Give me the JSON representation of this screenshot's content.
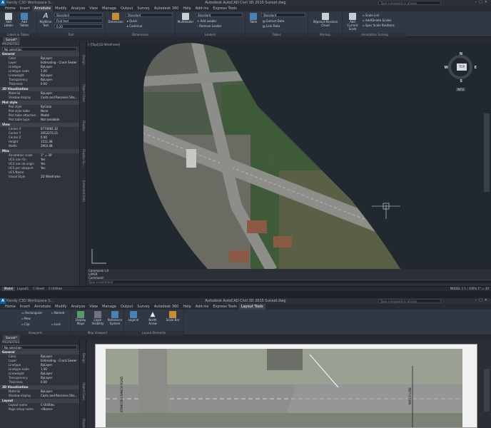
{
  "w1": {
    "title": "Autodesk AutoCAD Civil 3D 2015   Sunset.dwg",
    "qa": "Randy C3D Workspace S...",
    "search": "Type a keyword or phrase",
    "tabs": [
      "Home",
      "Insert",
      "Annotate",
      "Modify",
      "Analyze",
      "View",
      "Manage",
      "Output",
      "Survey",
      "Autodesk 360",
      "Help",
      "Add-ins",
      "Express Tools"
    ],
    "active_tab": "Annotate",
    "ribbon": {
      "labels_tables": {
        "b1": "Add Labels",
        "b2": "Add Tables",
        "label": "Labels & Tables"
      },
      "text": {
        "b1": "Multiline Text",
        "dd1": "Standard",
        "dd2": "Find text",
        "dd3": "0.20",
        "label": "Text"
      },
      "dim": {
        "b1": "Dimension",
        "dd1": "Standard",
        "s1": "Quick",
        "s2": "Continue",
        "label": "Dimensions"
      },
      "leaders": {
        "b1": "Multileader",
        "dd1": "Standard",
        "s1": "Add Leader",
        "s2": "Remove Leader",
        "label": "Leaders"
      },
      "tables": {
        "b1": "Table",
        "dd1": "Standard",
        "s1": "Extract Data",
        "s2": "Link Data",
        "label": "Tables"
      },
      "markup": {
        "b1": "Wipeout Revision Cloud",
        "label": "Markup"
      },
      "scaling": {
        "b1": "Add Current Scale",
        "s1": "Scale List",
        "s2": "Add/Delete Scales",
        "s3": "Sync Scale Positions",
        "label": "Annotation Scaling"
      }
    },
    "doc_tab": "Sunset*",
    "props": {
      "title": "PROPERTIES",
      "select": "No selection",
      "sections": [
        {
          "name": "General",
          "rows": [
            [
              "Color",
              "ByLayer"
            ],
            [
              "Layer",
              "Estimating - Crack Sealer"
            ],
            [
              "Linetype",
              "ByLayer"
            ],
            [
              "Linetype scale",
              "1.00"
            ],
            [
              "Lineweight",
              "ByLayer"
            ],
            [
              "Transparency",
              "ByLayer"
            ],
            [
              "Thickness",
              "0.00"
            ]
          ]
        },
        {
          "name": "3D Visualization",
          "rows": [
            [
              "Material",
              "ByLayer"
            ],
            [
              "Shadow display",
              "Casts and Receives Sha..."
            ]
          ]
        },
        {
          "name": "Plot style",
          "rows": [
            [
              "Plot style",
              "ByColor"
            ],
            [
              "Plot style table",
              "None"
            ],
            [
              "Plot table attached...",
              "Model"
            ],
            [
              "Plot table type",
              "Not available"
            ]
          ]
        },
        {
          "name": "View",
          "rows": [
            [
              "Center X",
              "6774681.32"
            ],
            [
              "Center Y",
              "2052275.21"
            ],
            [
              "Center Z",
              "0.00"
            ],
            [
              "Height",
              "1151.48"
            ],
            [
              "Width",
              "2903.48"
            ]
          ]
        },
        {
          "name": "Misc",
          "rows": [
            [
              "Annotation scale",
              "1\" = 30'"
            ],
            [
              "UCS icon On",
              "Yes"
            ],
            [
              "UCS icon at origin",
              "Yes"
            ],
            [
              "UCS per viewport",
              "Yes"
            ],
            [
              "UCS Name",
              ""
            ],
            [
              "Visual Style",
              "2D Wireframe"
            ]
          ]
        }
      ]
    },
    "vtabs": [
      "Design",
      "Object Class",
      "Display",
      "Display Qu...",
      "Extended Data"
    ],
    "viewport_label": "[-][Top][2D Wireframe]",
    "viewcube": {
      "face": "TOP",
      "n": "N",
      "s": "S",
      "e": "E",
      "w": "W",
      "wcs": "WCS"
    },
    "cmd": [
      "Command: LA",
      "LAYER",
      "Command:"
    ],
    "cmd_input": "Type a command",
    "status_tabs": [
      "Model",
      "Layout1",
      "C-Sheet",
      "C-Utilities"
    ],
    "status_right": "MODEL    1:1 / 100%   1\" = 30'"
  },
  "w2": {
    "title": "Autodesk AutoCAD Civil 3D 2015   Sunset.dwg",
    "qa": "Randy C3D Workspace S...",
    "search": "Type a keyword or phrase",
    "tabs": [
      "Home",
      "Insert",
      "Annotate",
      "Modify",
      "Analyze",
      "View",
      "Manage",
      "Output",
      "Survey",
      "Autodesk 360",
      "Help",
      "Add-ins",
      "Express Tools",
      "Layout Tools"
    ],
    "active_tab": "Layout Tools",
    "ribbon": {
      "viewport": {
        "s1": "Rectangular",
        "s2": "Named",
        "s3": "New",
        "s4": "Clip",
        "s5": "Lock",
        "label": "Viewports"
      },
      "mapvp": {
        "b1": "Display Maps",
        "b2": "Layer Visibility",
        "b3": "Reference System",
        "label": "Map Viewport"
      },
      "layout": {
        "b1": "Legend",
        "b2": "North Arrow",
        "b3": "Scale Bar",
        "label": "Layout Elements"
      }
    },
    "doc_tab": "Sunset*",
    "props": {
      "title": "PROPERTIES",
      "select": "No selection",
      "sections": [
        {
          "name": "General",
          "rows": [
            [
              "Color",
              "ByLayer"
            ],
            [
              "Layer",
              "Estimating - Crack Sealer"
            ],
            [
              "Linetype",
              "ByLayer"
            ],
            [
              "Linetype scale",
              "1.00"
            ],
            [
              "Lineweight",
              "ByLayer"
            ],
            [
              "Transparency",
              "ByLayer"
            ],
            [
              "Thickness",
              "0.00"
            ]
          ]
        },
        {
          "name": "3D Visualization",
          "rows": [
            [
              "Material",
              "ByLayer"
            ],
            [
              "Shadow display",
              "Casts and Receives Sha..."
            ]
          ]
        },
        {
          "name": "Layout",
          "rows": [
            [
              "Layout name",
              "C-Utilities"
            ],
            [
              "Page setup name",
              "<None>"
            ]
          ]
        }
      ]
    },
    "vtabs": [
      "Design",
      "Object Class",
      "Display"
    ],
    "road_label": "STANFORD RANCH ROAD",
    "match_label": "MATCH LINE"
  }
}
